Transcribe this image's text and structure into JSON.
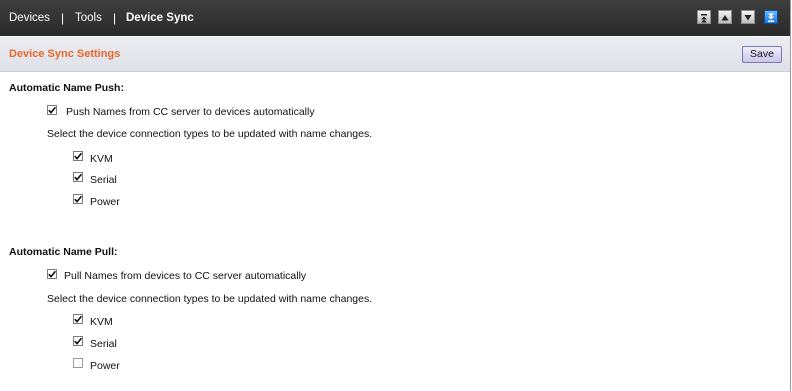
{
  "breadcrumb": {
    "devices": "Devices",
    "tools": "Tools",
    "current": "Device Sync",
    "separator": "|"
  },
  "nav_buttons": [
    {
      "icon": "scroll-to-top-icon",
      "active": false
    },
    {
      "icon": "scroll-up-icon",
      "active": false
    },
    {
      "icon": "scroll-down-icon",
      "active": false
    },
    {
      "icon": "scroll-to-bottom-icon",
      "active": true
    }
  ],
  "header": {
    "title": "Device Sync Settings",
    "save_label": "Save"
  },
  "push": {
    "heading": "Automatic Name Push:",
    "main_option": {
      "label": "Push Names from CC server to devices automatically",
      "checked": true
    },
    "instruction": "Select the device connection types to be updated with name changes.",
    "types": [
      {
        "label": "KVM",
        "checked": true
      },
      {
        "label": "Serial",
        "checked": true
      },
      {
        "label": "Power",
        "checked": true
      }
    ]
  },
  "pull": {
    "heading": "Automatic Name Pull:",
    "main_option": {
      "label": "Pull Names from devices to CC server automatically",
      "checked": true
    },
    "instruction": "Select the device connection types to be updated with name changes.",
    "types": [
      {
        "label": "KVM",
        "checked": true
      },
      {
        "label": "Serial",
        "checked": true
      },
      {
        "label": "Power",
        "checked": false
      }
    ]
  },
  "colors": {
    "accent": "#e8672a",
    "topbar": "#333333",
    "active_nav": "#2e86e6"
  }
}
